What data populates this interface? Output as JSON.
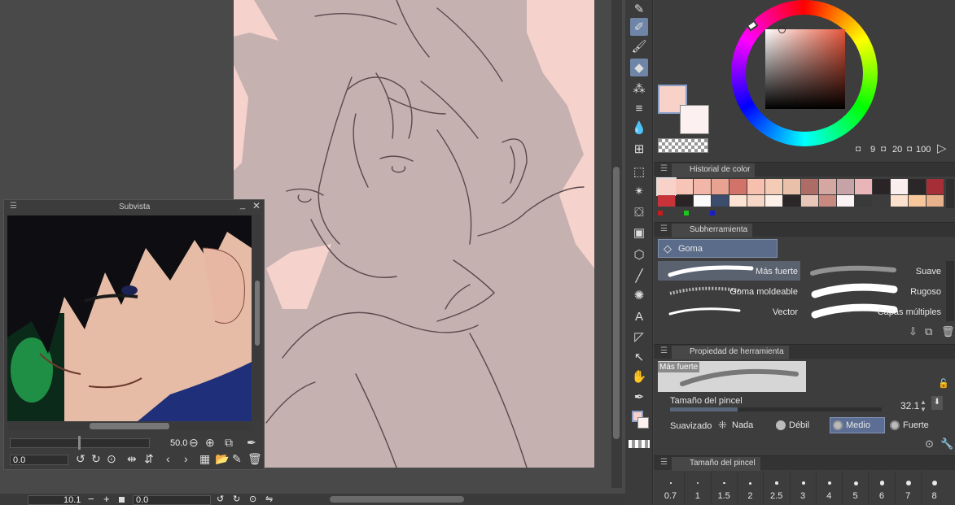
{
  "subview": {
    "title": "Subvista",
    "zoom": "50.0",
    "angle": "0.0"
  },
  "canvas_nav": {
    "zoom": "10.1",
    "angle": "0.0"
  },
  "color_wheel": {
    "main_color": "#f8d2c9",
    "sub_color": "#fdf0f0",
    "readout_h": "9",
    "readout_s": "20",
    "readout_v": "100"
  },
  "color_history": {
    "tab_label": "Historial de color",
    "row1": [
      "#f8d2c9",
      "#f6c5b8",
      "#f1b6a8",
      "#e8a292",
      "#d2736a",
      "#f7bfae",
      "#f4cbb5",
      "#e9c1aa",
      "#ad6c66",
      "#d4a7a3",
      "#c5a3a6",
      "#eab5b9",
      "#2a2426",
      "#fbeeee",
      "#2b2729",
      "#a62f37"
    ],
    "row2": [
      "#c8333a",
      "#2a2426",
      "#fafafa",
      "#3b4c6d",
      "#fce3d3",
      "#f6d6c7",
      "#fdf0e8",
      "#2b2729",
      "#e9c7b8",
      "#c88a80",
      "#fbf3f3",
      "#3a3a3a",
      "#3c3c3c",
      "#fde1cf",
      "#f7c69a",
      "#e7b18b"
    ]
  },
  "subtool": {
    "tab_label": "Subherramienta",
    "group": "Goma",
    "items": [
      {
        "label": "Más fuerte"
      },
      {
        "label": "Suave"
      },
      {
        "label": "Goma moldeable"
      },
      {
        "label": "Rugoso"
      },
      {
        "label": "Vector"
      },
      {
        "label": "Capas múltiples"
      }
    ]
  },
  "tool_property": {
    "tab_label": "Propiedad de herramienta",
    "preview_label": "Más fuerte",
    "brush_size_label": "Tamaño del pincel",
    "brush_size_value": "32.1",
    "brush_size_fraction": 0.32,
    "smoothing_label": "Suavizado",
    "smoothing_options": [
      "Nada",
      "Débil",
      "Medio",
      "Fuerte"
    ],
    "smoothing_selected": "Medio"
  },
  "brush_size_panel": {
    "tab_label": "Tamaño del pincel",
    "sizes": [
      "0.7",
      "1",
      "1.5",
      "2",
      "2.5",
      "3",
      "4",
      "5",
      "6",
      "7",
      "8"
    ]
  }
}
